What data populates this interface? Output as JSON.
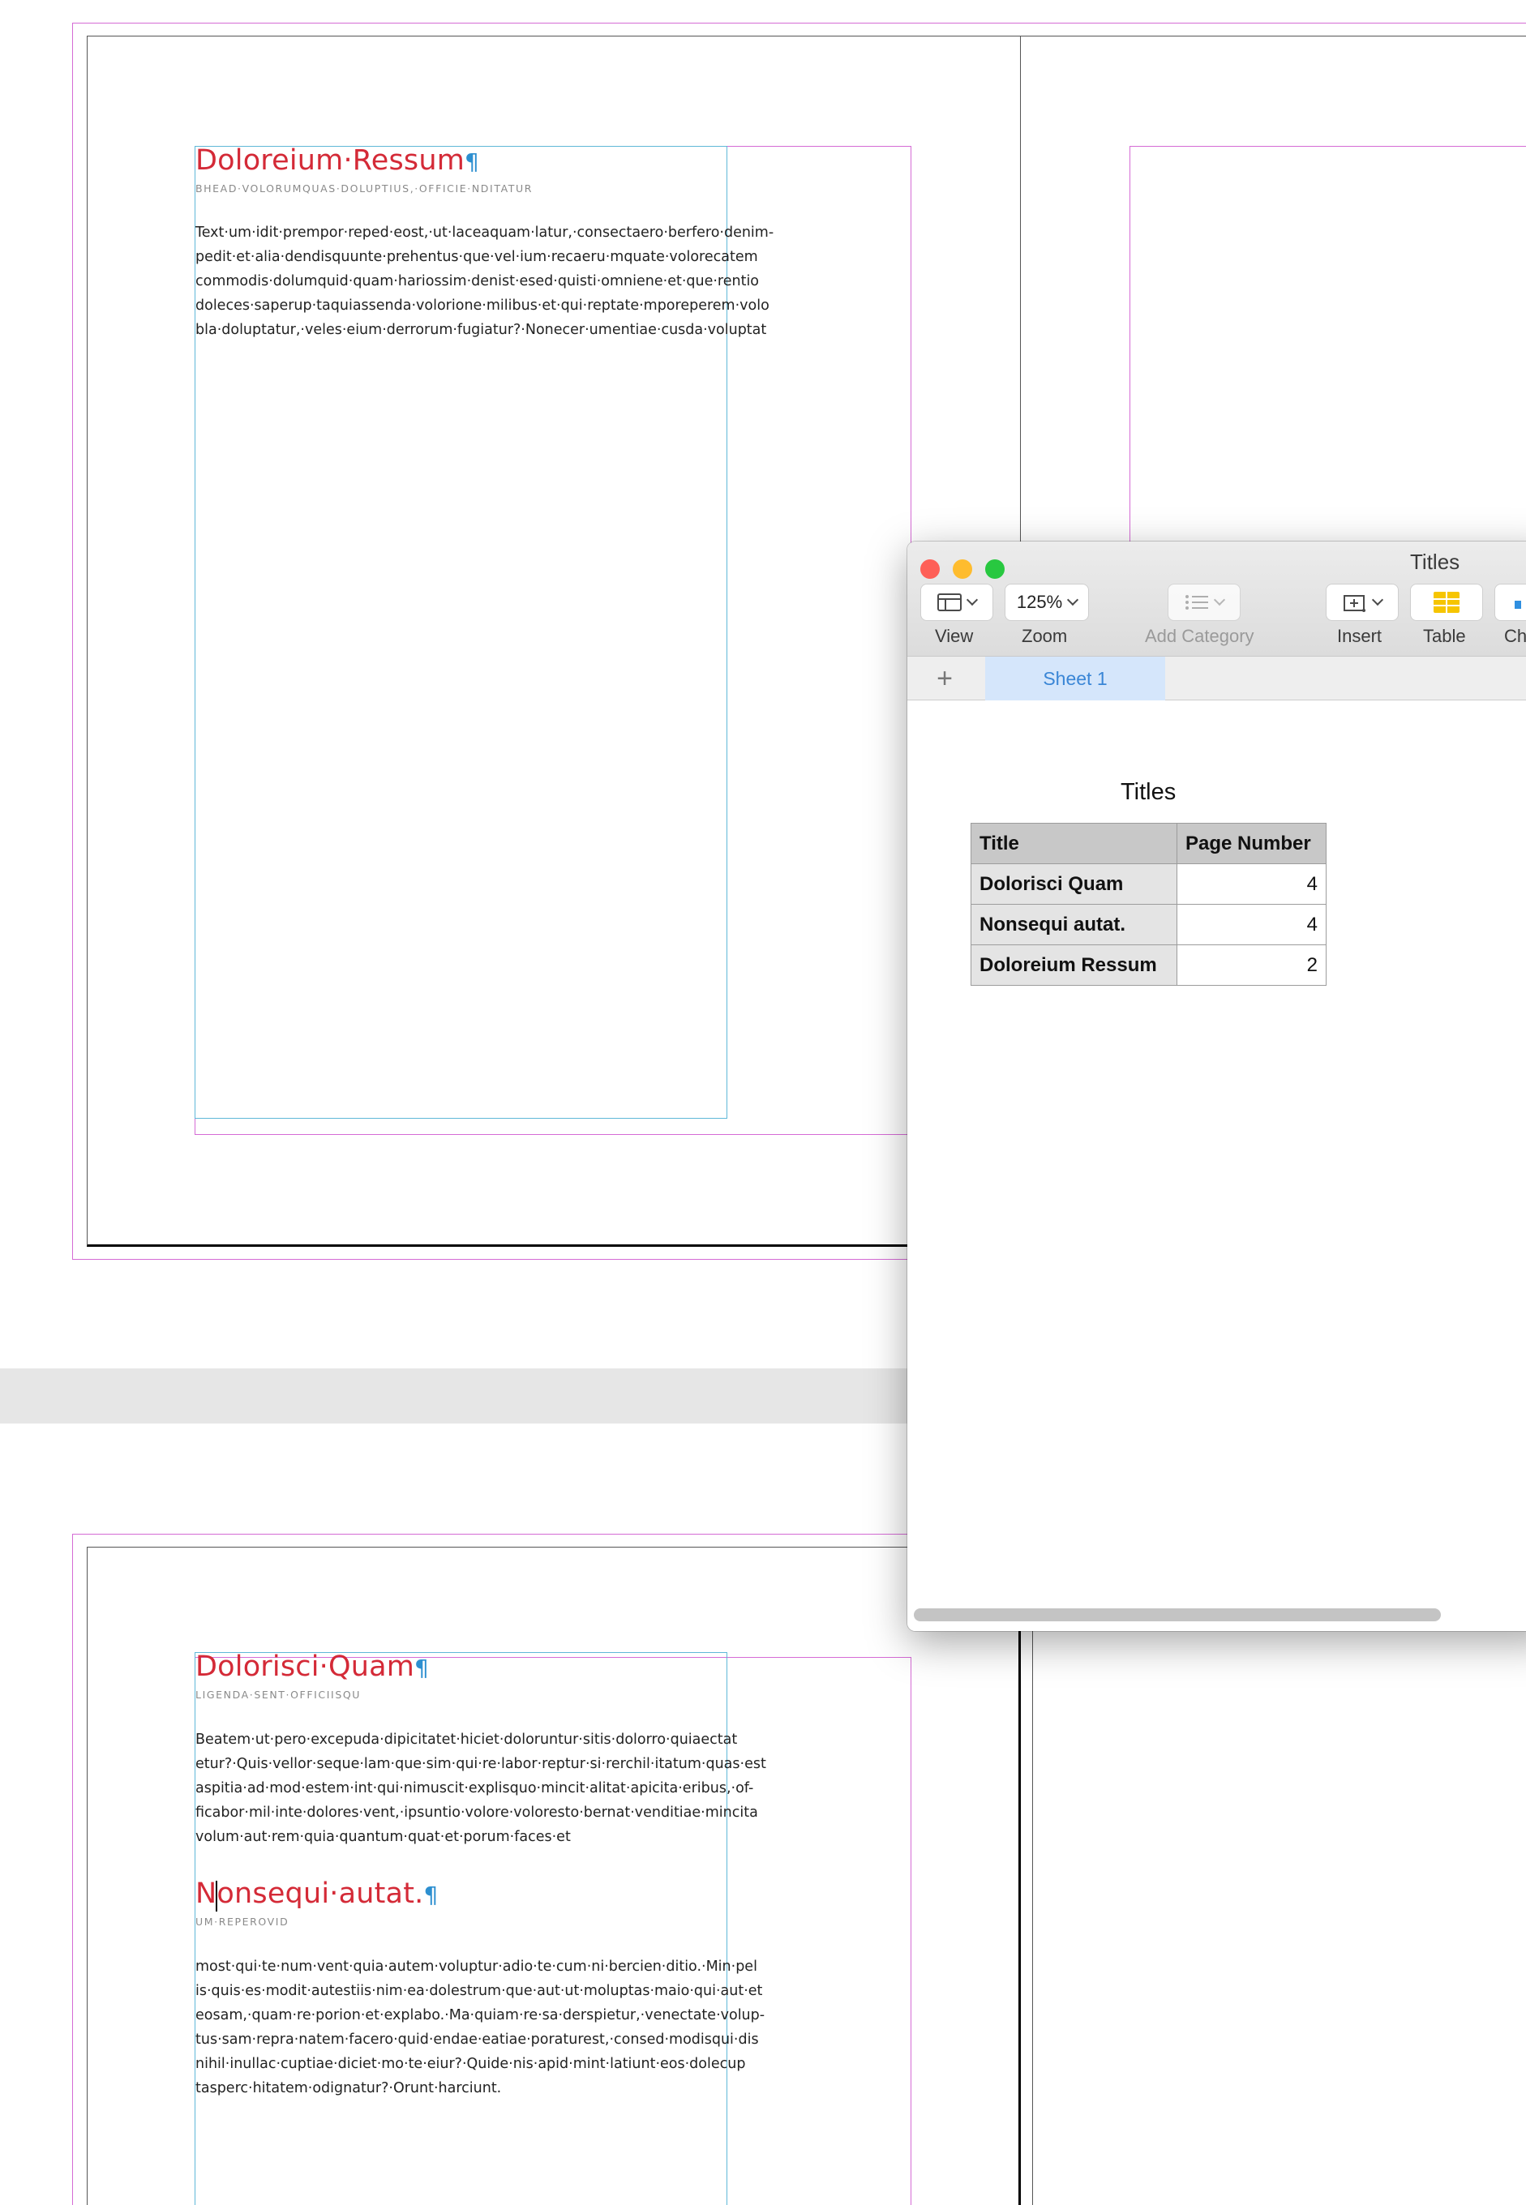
{
  "document": {
    "page1": {
      "heading": "Doloreium·Ressum",
      "pilcrow": "¶",
      "subhead": "BHEAD·VOLORUMQUAS·DOLUPTIUS,·OFFICIE·NDITATUR",
      "body": [
        "Text·um·idit·prempor·reped·eost,·ut·laceaquam·latur,·consectaero·berfero·denim-",
        "pedit·et·alia·dendisquunte·prehentus·que·vel·ium·recaeru·mquate·volorecatem",
        "commodis·dolumquid·quam·hariossim·denist·esed·quisti·omniene·et·que·rentio",
        "doleces·saperup·taquiassenda·volorione·milibus·et·qui·reptate·mporeperem·volo",
        "bla·doluptatur,·veles·eium·derrorum·fugiatur?·Nonecer·umentiae·cusda·voluptat"
      ]
    },
    "page2": {
      "heading": "Dolorisci·Quam",
      "subhead": "LIGENDA·SENT·OFFICIISQU",
      "body": [
        "Beatem·ut·pero·excepuda·dipicitatet·hiciet·doloruntur·sitis·dolorro·quiaectat",
        "etur?·Quis·vellor·seque·lam·que·sim·qui·re·labor·reptur·si·rerchil·itatum·quas·est",
        "aspitia·ad·mod·estem·int·qui·nimuscit·explisquo·mincit·alitat·apicita·eribus,·of-",
        "ficabor·mil·inte·dolores·vent,·ipsuntio·volore·voloresto·bernat·venditiae·mincita",
        "volum·aut·rem·quia·quantum·quat·et·porum·faces·et"
      ],
      "heading2": "Nonsequi·autat.",
      "subhead2": "UM·REPEROVID",
      "body2": [
        "most·qui·te·num·vent·quia·autem·voluptur·adio·te·cum·ni·bercien·ditio.·Min·pel",
        "is·quis·es·modit·autestiis·nim·ea·dolestrum·que·aut·ut·moluptas·maio·qui·aut·et",
        "eosam,·quam·re·porion·et·explabo.·Ma·quiam·re·sa·derspietur,·venectate·volup-",
        "tus·sam·repra·natem·facero·quid·endae·eatiae·poraturest,·consed·modisqui·dis",
        "nihil·inullac·cuptiae·diciet·mo·te·eiur?·Quide·nis·apid·mint·latiunt·eos·dolecup",
        "tasperc·hitatem·odignatur?·Orunt·harciunt."
      ]
    }
  },
  "numbers_window": {
    "title": "Titles",
    "toolbar": {
      "view_label": "View",
      "zoom_value": "125%",
      "zoom_label": "Zoom",
      "add_category_label": "Add Category",
      "insert_label": "Insert",
      "table_label": "Table",
      "chart_label": "Ch"
    },
    "sheets": {
      "add_symbol": "+",
      "active": "Sheet 1"
    },
    "table": {
      "title": "Titles",
      "columns": [
        "Title",
        "Page Number"
      ],
      "rows": [
        {
          "title": "Dolorisci Quam",
          "page": "4"
        },
        {
          "title": "Nonsequi autat.",
          "page": "4"
        },
        {
          "title": "Doloreium Ressum",
          "page": "2"
        }
      ]
    },
    "colors": {
      "close": "#fe5f57",
      "minimize": "#febc2e",
      "zoom": "#28c840",
      "accent": "#3a86d6"
    }
  }
}
